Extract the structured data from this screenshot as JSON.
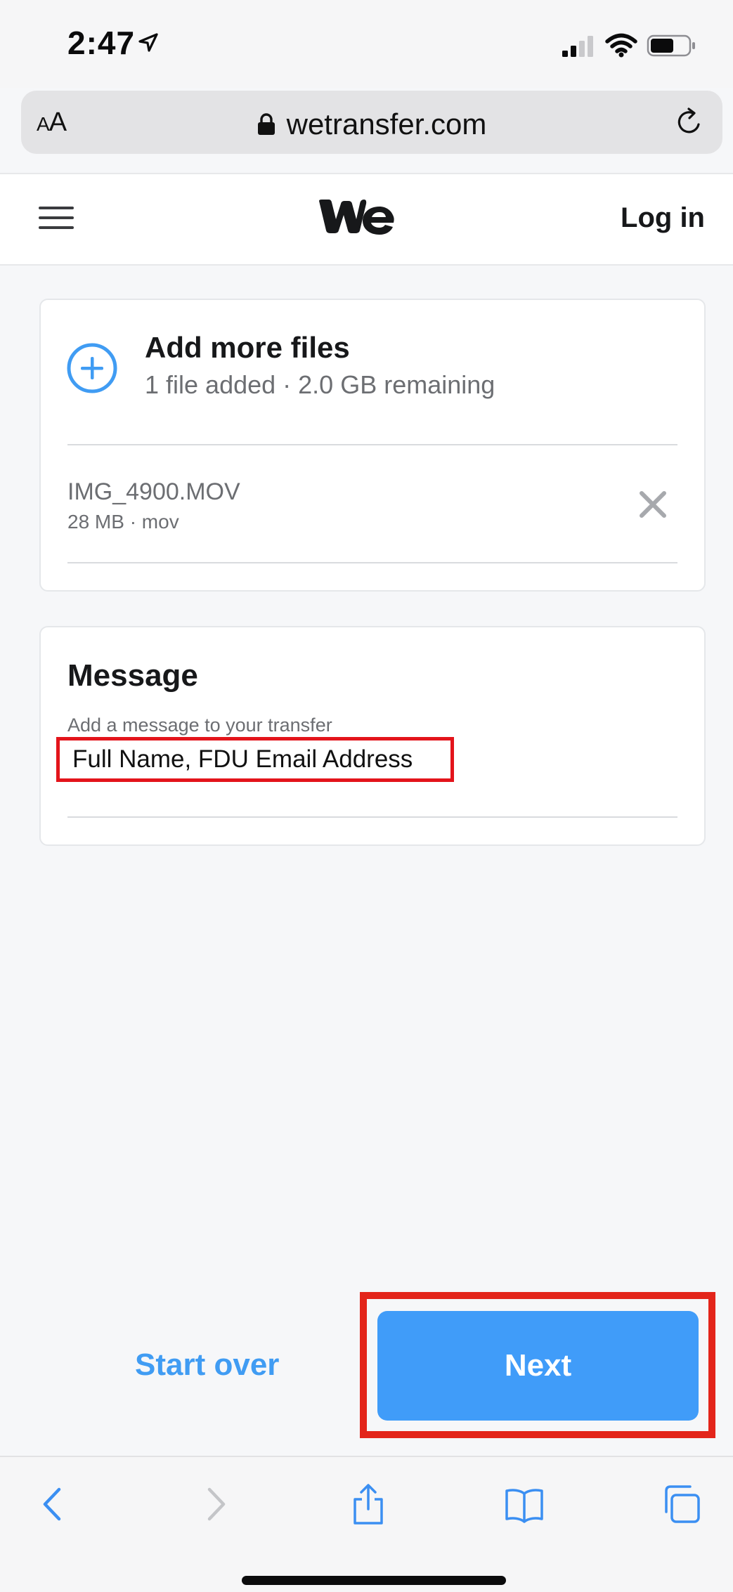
{
  "status_bar": {
    "time": "2:47"
  },
  "address_bar": {
    "text_size_label_small": "A",
    "text_size_label_large": "A",
    "url": "wetransfer.com"
  },
  "header": {
    "login_label": "Log in"
  },
  "files_card": {
    "title": "Add more files",
    "subtitle": "1 file added · 2.0 GB remaining",
    "files": [
      {
        "name": "IMG_4900.MOV",
        "meta": "28 MB · mov"
      }
    ]
  },
  "message_card": {
    "title": "Message",
    "label": "Add a message to your transfer",
    "value": "Full Name, FDU Email Address"
  },
  "actions": {
    "start_over_label": "Start over",
    "next_label": "Next"
  },
  "colors": {
    "accent": "#409cf9",
    "highlight_red": "#e3251b",
    "text_primary": "#17181a",
    "text_secondary": "#6c6e72"
  },
  "icons": {
    "menu": "menu-icon",
    "logo": "wetransfer-logo-icon",
    "add": "plus-circle-icon",
    "remove": "close-icon",
    "lock": "lock-icon",
    "reload": "reload-icon",
    "back": "chevron-left-icon",
    "forward": "chevron-right-icon",
    "share": "share-icon",
    "bookmarks": "book-icon",
    "tabs": "tabs-icon"
  }
}
